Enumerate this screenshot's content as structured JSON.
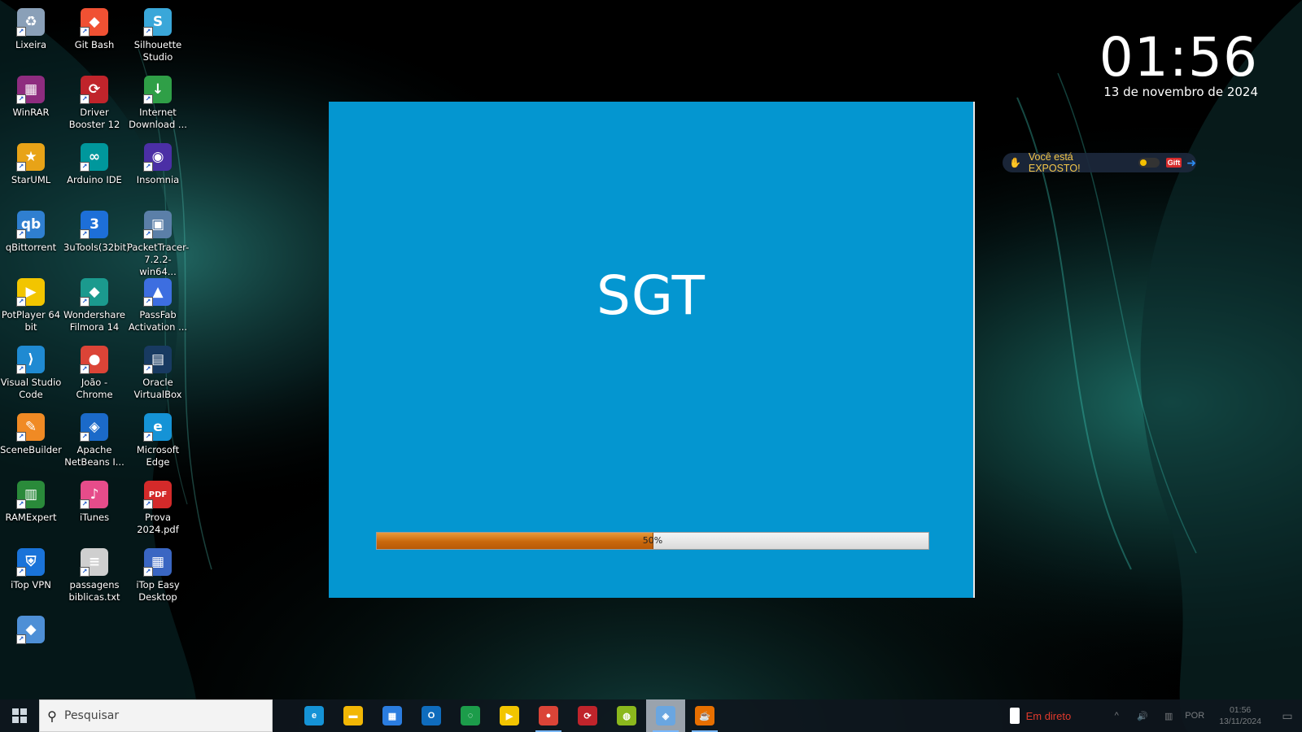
{
  "desktop": {
    "icons": [
      {
        "label": "Lixeira",
        "icon": "recycle-bin-icon",
        "glyph": "♻",
        "color": "#8aa0b8"
      },
      {
        "label": "Git Bash",
        "icon": "git-bash-icon",
        "glyph": "◆",
        "color": "#f05133"
      },
      {
        "label": "Silhouette Studio",
        "icon": "silhouette-studio-icon",
        "glyph": "S",
        "color": "#3aa7d9"
      },
      {
        "label": "WinRAR",
        "icon": "winrar-icon",
        "glyph": "▦",
        "color": "#8e2c7f"
      },
      {
        "label": "Driver Booster 12",
        "icon": "driver-booster-icon",
        "glyph": "⟳",
        "color": "#c0242b"
      },
      {
        "label": "Internet Download ...",
        "icon": "internet-download-manager-icon",
        "glyph": "↓",
        "color": "#2f9f47"
      },
      {
        "label": "StarUML",
        "icon": "staruml-icon",
        "glyph": "★",
        "color": "#e8a317"
      },
      {
        "label": "Arduino IDE",
        "icon": "arduino-ide-icon",
        "glyph": "∞",
        "color": "#00979c"
      },
      {
        "label": "Insomnia",
        "icon": "insomnia-icon",
        "glyph": "◉",
        "color": "#4b2fa5"
      },
      {
        "label": "qBittorrent",
        "icon": "qbittorrent-icon",
        "glyph": "qb",
        "color": "#2f7fd0"
      },
      {
        "label": "3uTools(32bit)",
        "icon": "3utools-icon",
        "glyph": "3",
        "color": "#1d6fd8"
      },
      {
        "label": "PacketTracer-7.2.2-win64...",
        "icon": "packet-tracer-installer-icon",
        "glyph": "▣",
        "color": "#5b7fa8"
      },
      {
        "label": "PotPlayer 64 bit",
        "icon": "potplayer-icon",
        "glyph": "▶",
        "color": "#f2c500"
      },
      {
        "label": "Wondershare Filmora 14",
        "icon": "filmora-icon",
        "glyph": "◆",
        "color": "#1b9a8e"
      },
      {
        "label": "PassFab Activation ...",
        "icon": "passfab-icon",
        "glyph": "▲",
        "color": "#3d6ee0"
      },
      {
        "label": "Visual Studio Code",
        "icon": "vscode-icon",
        "glyph": "⟩",
        "color": "#1f8ad2"
      },
      {
        "label": "João - Chrome",
        "icon": "chrome-profile-icon",
        "glyph": "●",
        "color": "#db4437"
      },
      {
        "label": "Oracle VirtualBox",
        "icon": "virtualbox-icon",
        "glyph": "▤",
        "color": "#183a61"
      },
      {
        "label": "SceneBuilder",
        "icon": "scenebuilder-icon",
        "glyph": "✎",
        "color": "#f08a24"
      },
      {
        "label": "Apache NetBeans I...",
        "icon": "netbeans-icon",
        "glyph": "◈",
        "color": "#1b6ac9"
      },
      {
        "label": "Microsoft Edge",
        "icon": "edge-icon",
        "glyph": "e",
        "color": "#1593d6"
      },
      {
        "label": "RAMExpert",
        "icon": "ramexpert-icon",
        "glyph": "▥",
        "color": "#2a8a3a"
      },
      {
        "label": "iTunes",
        "icon": "itunes-icon",
        "glyph": "♪",
        "color": "#e64c8a"
      },
      {
        "label": "Prova 2024.pdf",
        "icon": "pdf-file-icon",
        "glyph": "PDF",
        "color": "#d42a2a"
      },
      {
        "label": "iTop VPN",
        "icon": "itop-vpn-icon",
        "glyph": "⛨",
        "color": "#1a73d9"
      },
      {
        "label": "passagens biblicas.txt",
        "icon": "text-file-icon",
        "glyph": "≡",
        "color": "#cfcfcf"
      },
      {
        "label": "iTop Easy Desktop",
        "icon": "itop-easy-desktop-icon",
        "glyph": "▦",
        "color": "#3a66c2"
      },
      {
        "label": "",
        "icon": "app-shortcut-icon",
        "glyph": "◆",
        "color": "#4e8fd6"
      }
    ]
  },
  "clock": {
    "time": "01:56",
    "date": "13 de novembro de 2024"
  },
  "vpn_widget": {
    "status": "Você está EXPOSTO!",
    "gift_label": "Gift",
    "accent": "#f5c84a"
  },
  "splash": {
    "title": "SGT",
    "progress_percent": 50,
    "progress_label": "50%",
    "background": "#0496d0"
  },
  "taskbar": {
    "search_placeholder": "Pesquisar",
    "apps": [
      {
        "name": "edge",
        "glyph": "e",
        "color": "#1593d6",
        "running": false,
        "active": false
      },
      {
        "name": "file-explorer",
        "glyph": "▬",
        "color": "#f2b705",
        "running": false,
        "active": false
      },
      {
        "name": "microsoft-store",
        "glyph": "▦",
        "color": "#2b7de0",
        "running": false,
        "active": false
      },
      {
        "name": "outlook",
        "glyph": "O",
        "color": "#0f6cbd",
        "running": false,
        "active": false
      },
      {
        "name": "spotify-like",
        "glyph": "◌",
        "color": "#1c9c4a",
        "running": false,
        "active": false
      },
      {
        "name": "potplayer",
        "glyph": "▶",
        "color": "#f2c500",
        "running": false,
        "active": false
      },
      {
        "name": "chrome",
        "glyph": "●",
        "color": "#db4437",
        "running": true,
        "active": false
      },
      {
        "name": "driver-booster",
        "glyph": "⟳",
        "color": "#c0242b",
        "running": false,
        "active": false
      },
      {
        "name": "chameleon",
        "glyph": "◍",
        "color": "#8bb81d",
        "running": false,
        "active": false
      },
      {
        "name": "netbeans",
        "glyph": "◈",
        "color": "#6aa6e0",
        "running": true,
        "active": true
      },
      {
        "name": "java",
        "glyph": "☕",
        "color": "#e76f00",
        "running": true,
        "active": false
      }
    ],
    "tray": {
      "live_label": "Em direto",
      "lang": "POR",
      "time": "01:56",
      "date": "13/11/2024"
    }
  }
}
